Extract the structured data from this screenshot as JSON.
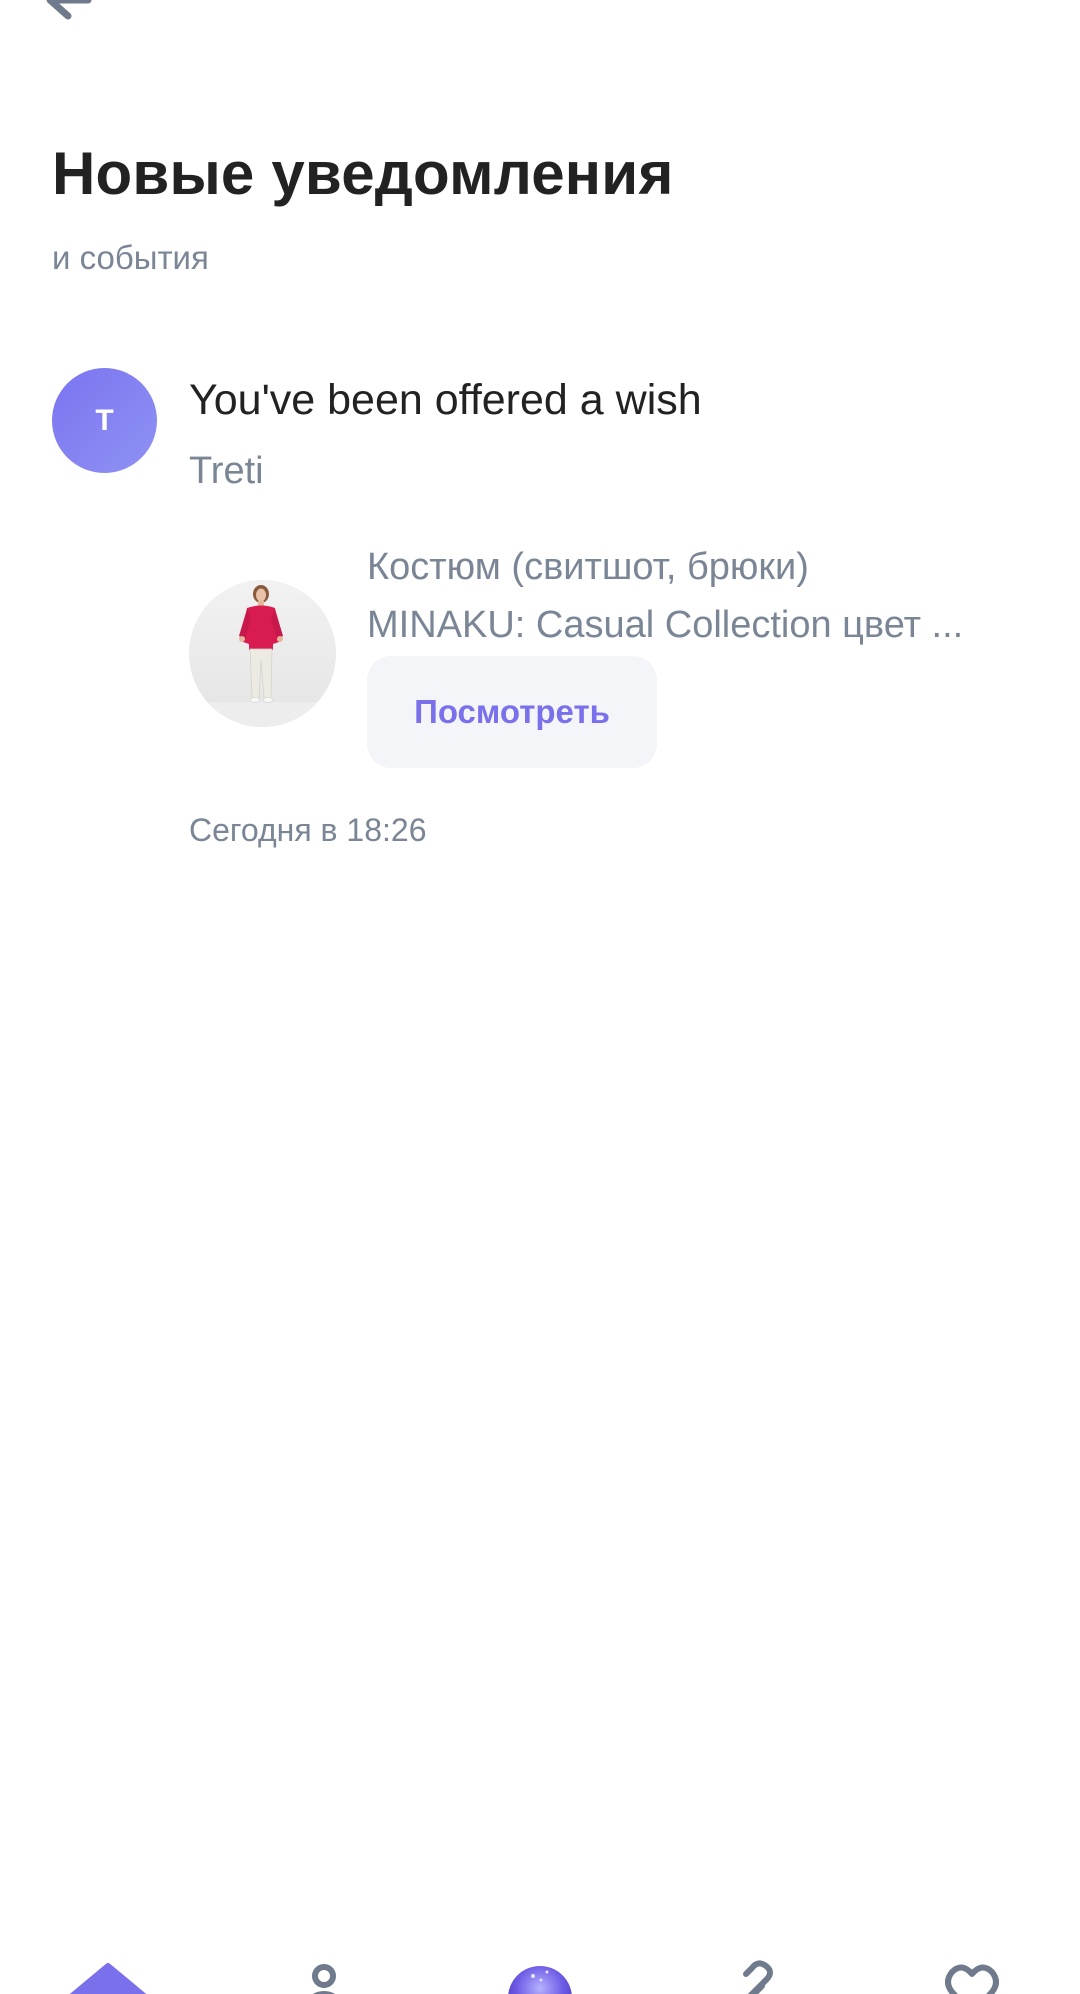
{
  "header": {
    "title": "Новые уведомления",
    "subtitle": "и события"
  },
  "notification": {
    "avatar_letter": "T",
    "title": "You've been offered a wish",
    "sender": "Treti",
    "product_line_1": "Костюм (свитшот, брюки)",
    "product_line_2": "MINAKU: Casual Collection цвет ...",
    "view_button_label": "Посмотреть",
    "timestamp": "Сегодня в 18:26"
  },
  "icons": {
    "back": "arrow-left-icon",
    "nav": [
      "home-icon",
      "user-icon",
      "orb-icon",
      "link-icon",
      "heart-icon"
    ]
  },
  "colors": {
    "accent": "#7a70ec",
    "avatar_gradient_start": "#7b74f0",
    "avatar_gradient_end": "#8f92f4",
    "muted_text": "#7a8596",
    "button_bg": "#f4f5f9"
  }
}
